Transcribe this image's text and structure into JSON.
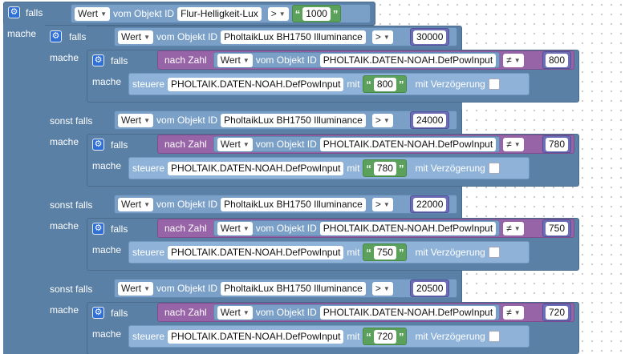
{
  "outer": {
    "falls_label": "falls",
    "mache_label": "mache",
    "condition": {
      "wert_label": "Wert",
      "vom_label": "vom Objekt ID",
      "object_id": "Flur-Helligkeit-Lux",
      "op": ">",
      "value": "1000"
    }
  },
  "inner": {
    "falls_label": "falls",
    "sonst_falls_label": "sonst falls",
    "mache_label": "mache",
    "wert_label": "Wert",
    "vom_label": "vom Objekt ID",
    "object_id": "PholtaikLux BH1750  Illuminance",
    "op": ">",
    "branches": [
      {
        "threshold": "30000",
        "nested": {
          "falls_label": "falls",
          "mache_label": "mache",
          "nach_zahl_label": "nach Zahl",
          "wert_label": "Wert",
          "vom_label": "vom Objekt ID",
          "object_id": "PHOLTAIK.DATEN-NOAH.DefPowInput",
          "op": "≠",
          "compare": "800",
          "steuere_label": "steuere",
          "steuere_id": "PHOLTAIK.DATEN-NOAH.DefPowInput",
          "mit_label": "mit",
          "set_value": "800",
          "delay_label": "mit Verzögerung"
        }
      },
      {
        "threshold": "24000",
        "nested": {
          "falls_label": "falls",
          "mache_label": "mache",
          "nach_zahl_label": "nach Zahl",
          "wert_label": "Wert",
          "vom_label": "vom Objekt ID",
          "object_id": "PHOLTAIK.DATEN-NOAH.DefPowInput",
          "op": "≠",
          "compare": "780",
          "steuere_label": "steuere",
          "steuere_id": "PHOLTAIK.DATEN-NOAH.DefPowInput",
          "mit_label": "mit",
          "set_value": "780",
          "delay_label": "mit Verzögerung"
        }
      },
      {
        "threshold": "22000",
        "nested": {
          "falls_label": "falls",
          "mache_label": "mache",
          "nach_zahl_label": "nach Zahl",
          "wert_label": "Wert",
          "vom_label": "vom Objekt ID",
          "object_id": "PHOLTAIK.DATEN-NOAH.DefPowInput",
          "op": "≠",
          "compare": "750",
          "steuere_label": "steuere",
          "steuere_id": "PHOLTAIK.DATEN-NOAH.DefPowInput",
          "mit_label": "mit",
          "set_value": "750",
          "delay_label": "mit Verzögerung"
        }
      },
      {
        "threshold": "20500",
        "nested": {
          "falls_label": "falls",
          "mache_label": "mache",
          "nach_zahl_label": "nach Zahl",
          "wert_label": "Wert",
          "vom_label": "vom Objekt ID",
          "object_id": "PHOLTAIK.DATEN-NOAH.DefPowInput",
          "op": "≠",
          "compare": "720",
          "steuere_label": "steuere",
          "steuere_id": "PHOLTAIK.DATEN-NOAH.DefPowInput",
          "mit_label": "mit",
          "set_value": "720",
          "delay_label": "mit Verzögerung"
        }
      }
    ]
  }
}
